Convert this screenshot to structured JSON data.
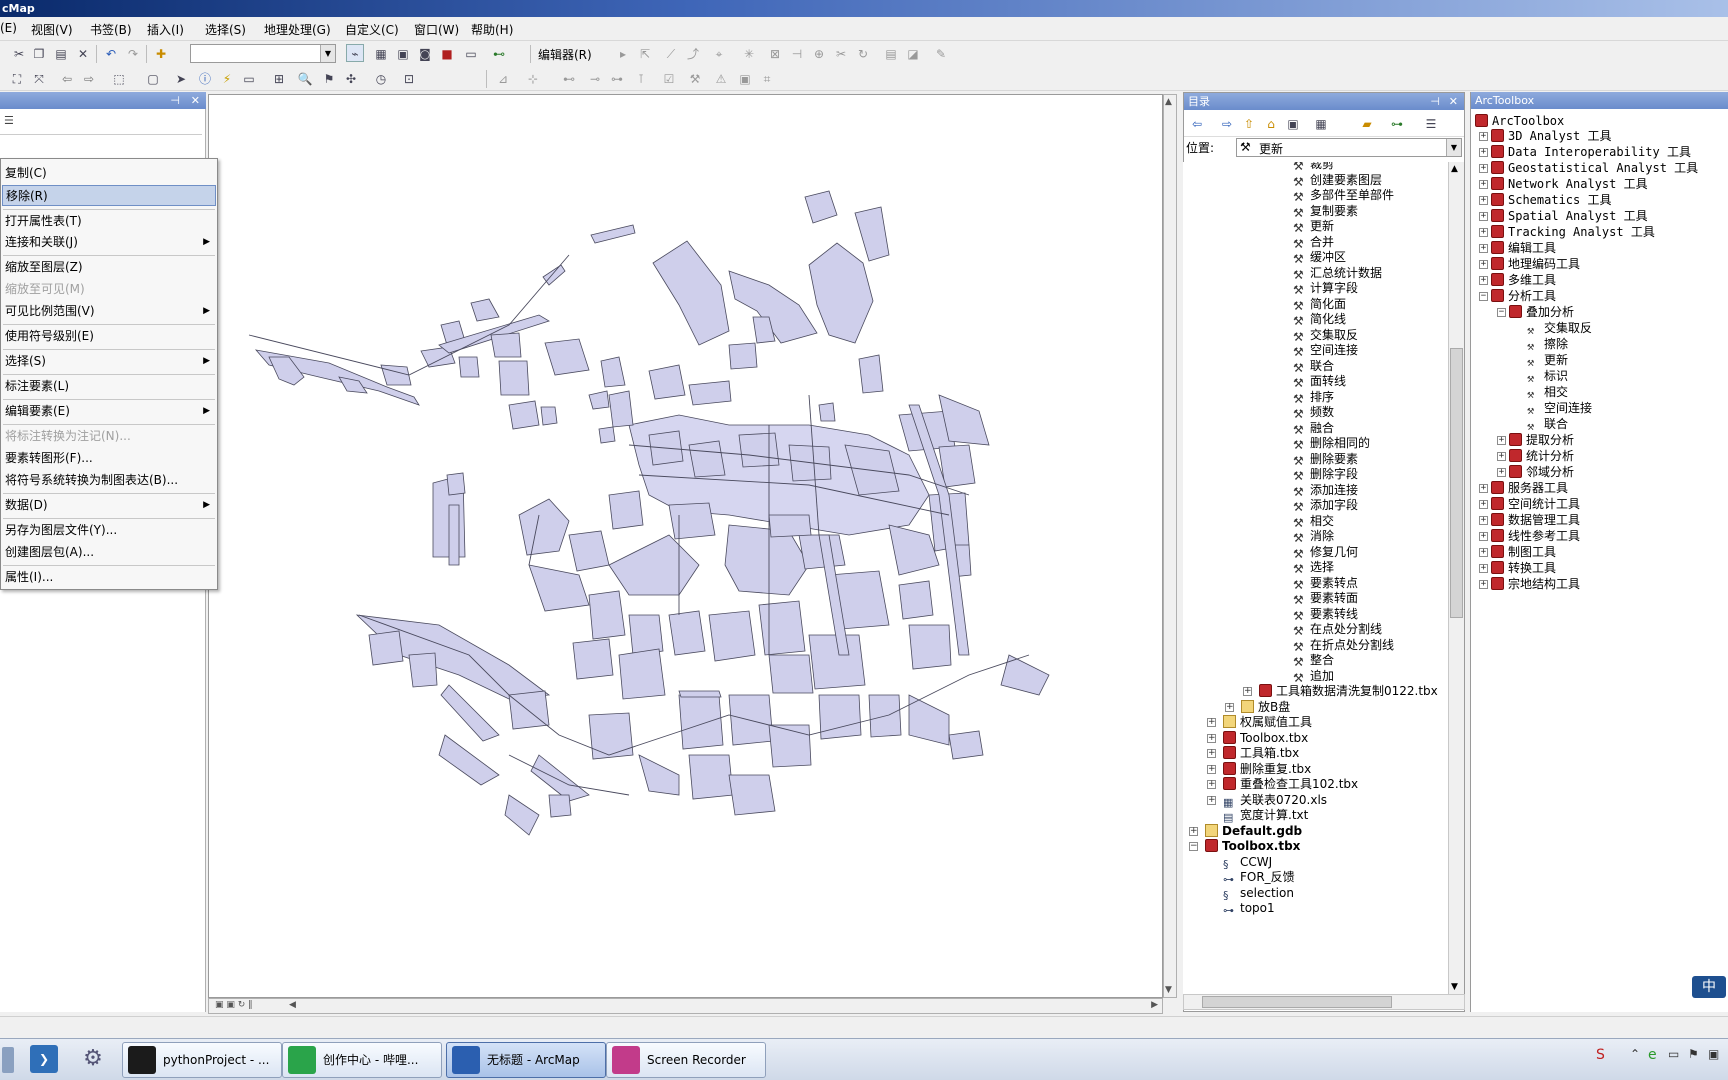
{
  "window": {
    "title": "cMap"
  },
  "menu": [
    "(E)",
    "视图(V)",
    "书签(B)",
    "插入(I)",
    "选择(S)",
    "地理处理(G)",
    "自定义(C)",
    "窗口(W)",
    "帮助(H)"
  ],
  "toolbar": {
    "editor_label": "编辑器(R)"
  },
  "context_menu": [
    {
      "label": "复制(C)",
      "state": "normal"
    },
    {
      "label": "移除(R)",
      "state": "highlight"
    },
    {
      "label": "打开属性表(T)",
      "state": "normal"
    },
    {
      "label": "连接和关联(J)",
      "state": "normal",
      "sub": true
    },
    {
      "label": "缩放至图层(Z)",
      "state": "normal"
    },
    {
      "label": "缩放至可见(M)",
      "state": "disabled"
    },
    {
      "label": "可见比例范围(V)",
      "state": "normal",
      "sub": true
    },
    {
      "label": "使用符号级别(E)",
      "state": "normal"
    },
    {
      "label": "选择(S)",
      "state": "normal",
      "sub": true
    },
    {
      "label": "标注要素(L)",
      "state": "normal"
    },
    {
      "label": "编辑要素(E)",
      "state": "normal",
      "sub": true
    },
    {
      "label": "将标注转换为注记(N)...",
      "state": "disabled"
    },
    {
      "label": "要素转图形(F)...",
      "state": "normal"
    },
    {
      "label": "将符号系统转换为制图表达(B)...",
      "state": "normal"
    },
    {
      "label": "数据(D)",
      "state": "normal",
      "sub": true
    },
    {
      "label": "另存为图层文件(Y)...",
      "state": "normal"
    },
    {
      "label": "创建图层包(A)...",
      "state": "normal"
    },
    {
      "label": "属性(I)...",
      "state": "normal"
    }
  ],
  "catalog": {
    "title": "目录",
    "location_label": "位置:",
    "location_value": "更新",
    "tools": [
      "裁剪",
      "创建要素图层",
      "多部件至单部件",
      "复制要素",
      "更新",
      "合并",
      "缓冲区",
      "汇总统计数据",
      "计算字段",
      "简化面",
      "简化线",
      "交集取反",
      "空间连接",
      "联合",
      "面转线",
      "排序",
      "频数",
      "融合",
      "删除相同的",
      "删除要素",
      "删除字段",
      "添加连接",
      "添加字段",
      "相交",
      "消除",
      "修复几何",
      "选择",
      "要素转点",
      "要素转面",
      "要素转线",
      "在点处分割线",
      "在折点处分割线",
      "整合",
      "追加"
    ],
    "items": [
      {
        "label": "工具箱数据清洗复制0122.tbx",
        "type": "tbx",
        "level": 4
      },
      {
        "label": "放B盘",
        "type": "folder",
        "level": 3
      },
      {
        "label": "权属赋值工具",
        "type": "folder",
        "level": 2
      },
      {
        "label": "Toolbox.tbx",
        "type": "tbx",
        "level": 2
      },
      {
        "label": "工具箱.tbx",
        "type": "tbx",
        "level": 2
      },
      {
        "label": "删除重复.tbx",
        "type": "tbx",
        "level": 2
      },
      {
        "label": "重叠检查工具102.tbx",
        "type": "tbx",
        "level": 2
      },
      {
        "label": "关联表0720.xls",
        "type": "xls",
        "level": 2
      },
      {
        "label": "宽度计算.txt",
        "type": "txt",
        "level": 2
      },
      {
        "label": "Default.gdb",
        "type": "gdb",
        "level": 1
      },
      {
        "label": "Toolbox.tbx",
        "type": "tbx",
        "level": 1
      },
      {
        "label": "CCWJ",
        "type": "script",
        "level": 2
      },
      {
        "label": "FOR_反馈",
        "type": "model",
        "level": 2
      },
      {
        "label": "selection",
        "type": "script",
        "level": 2
      },
      {
        "label": "topo1",
        "type": "model",
        "level": 2
      }
    ]
  },
  "arctoolbox": {
    "title": "ArcToolbox",
    "root": "ArcToolbox",
    "items": [
      {
        "label": "3D Analyst 工具",
        "level": 1,
        "pm": "+"
      },
      {
        "label": "Data Interoperability 工具",
        "level": 1,
        "pm": "+"
      },
      {
        "label": "Geostatistical Analyst 工具",
        "level": 1,
        "pm": "+"
      },
      {
        "label": "Network Analyst 工具",
        "level": 1,
        "pm": "+"
      },
      {
        "label": "Schematics 工具",
        "level": 1,
        "pm": "+"
      },
      {
        "label": "Spatial Analyst 工具",
        "level": 1,
        "pm": "+"
      },
      {
        "label": "Tracking Analyst 工具",
        "level": 1,
        "pm": "+"
      },
      {
        "label": "编辑工具",
        "level": 1,
        "pm": "+"
      },
      {
        "label": "地理编码工具",
        "level": 1,
        "pm": "+"
      },
      {
        "label": "多维工具",
        "level": 1,
        "pm": "+"
      },
      {
        "label": "分析工具",
        "level": 1,
        "pm": "-"
      },
      {
        "label": "叠加分析",
        "level": 2,
        "pm": "-"
      },
      {
        "label": "交集取反",
        "level": 3,
        "pm": ""
      },
      {
        "label": "擦除",
        "level": 3,
        "pm": ""
      },
      {
        "label": "更新",
        "level": 3,
        "pm": ""
      },
      {
        "label": "标识",
        "level": 3,
        "pm": ""
      },
      {
        "label": "相交",
        "level": 3,
        "pm": ""
      },
      {
        "label": "空间连接",
        "level": 3,
        "pm": ""
      },
      {
        "label": "联合",
        "level": 3,
        "pm": ""
      },
      {
        "label": "提取分析",
        "level": 2,
        "pm": "+"
      },
      {
        "label": "统计分析",
        "level": 2,
        "pm": "+"
      },
      {
        "label": "邻域分析",
        "level": 2,
        "pm": "+"
      },
      {
        "label": "服务器工具",
        "level": 1,
        "pm": "+"
      },
      {
        "label": "空间统计工具",
        "level": 1,
        "pm": "+"
      },
      {
        "label": "数据管理工具",
        "level": 1,
        "pm": "+"
      },
      {
        "label": "线性参考工具",
        "level": 1,
        "pm": "+"
      },
      {
        "label": "制图工具",
        "level": 1,
        "pm": "+"
      },
      {
        "label": "转换工具",
        "level": 1,
        "pm": "+"
      },
      {
        "label": "宗地结构工具",
        "level": 1,
        "pm": "+"
      }
    ]
  },
  "taskbar": [
    {
      "label": "pythonProject - ...",
      "icon": "pycharm-icon",
      "color": "#1b1b1b"
    },
    {
      "label": "创作中心 - 哔哩...",
      "icon": "browser-icon",
      "color": "#2aa44a"
    },
    {
      "label": "无标题 - ArcMap",
      "icon": "arcmap-icon",
      "color": "#2b5fb0",
      "active": true
    },
    {
      "label": "Screen Recorder",
      "icon": "recorder-icon",
      "color": "#c23b8a"
    }
  ],
  "ime": {
    "label": "中"
  }
}
